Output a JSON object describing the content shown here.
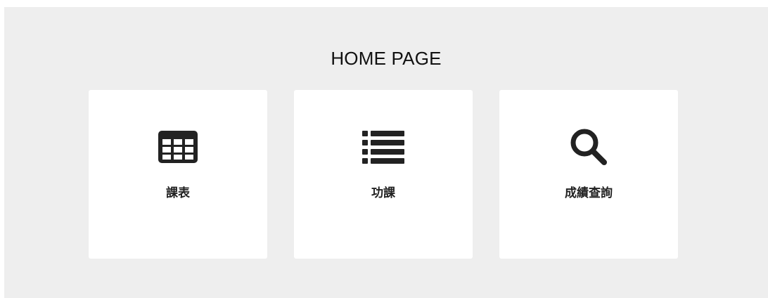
{
  "page": {
    "title": "HOME PAGE"
  },
  "cards": [
    {
      "label": "課表",
      "icon": "table-icon"
    },
    {
      "label": "功課",
      "icon": "list-icon"
    },
    {
      "label": "成績查詢",
      "icon": "search-icon"
    }
  ],
  "colors": {
    "background": "#eeeeee",
    "card": "#ffffff",
    "icon": "#222222",
    "text": "#111111"
  }
}
